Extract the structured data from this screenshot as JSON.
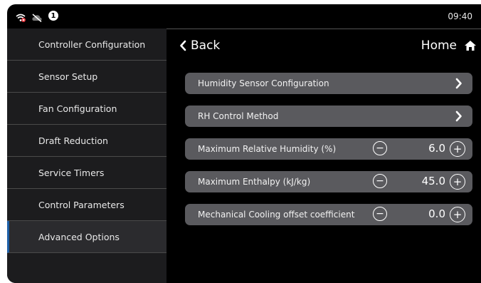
{
  "status": {
    "time": "09:40",
    "notification_count": "1"
  },
  "sidebar": {
    "items": [
      {
        "label": "Controller Configuration"
      },
      {
        "label": "Sensor Setup"
      },
      {
        "label": "Fan Configuration"
      },
      {
        "label": "Draft Reduction"
      },
      {
        "label": "Service Timers"
      },
      {
        "label": "Control Parameters"
      },
      {
        "label": "Advanced Options"
      }
    ],
    "active_index": 6
  },
  "header": {
    "back_label": "Back",
    "home_label": "Home"
  },
  "settings": {
    "rows": [
      {
        "label": "Humidity Sensor Configuration"
      },
      {
        "label": "RH Control Method"
      },
      {
        "label": "Maximum Relative Humidity (%)",
        "value": "6.0"
      },
      {
        "label": "Maximum Enthalpy (kJ/kg)",
        "value": "45.0"
      },
      {
        "label": "Mechanical Cooling offset coefficient",
        "value": "0.0"
      }
    ]
  },
  "colors": {
    "accent": "#1e5fa6",
    "row_bg": "#5a5a5e",
    "sidebar_bg": "#1c1c1e"
  },
  "icons": [
    "wifi-off-icon",
    "cloud-off-icon",
    "notification-icon",
    "chevron-left-icon",
    "home-icon",
    "chevron-right-icon",
    "minus-circle-icon",
    "plus-circle-icon"
  ]
}
